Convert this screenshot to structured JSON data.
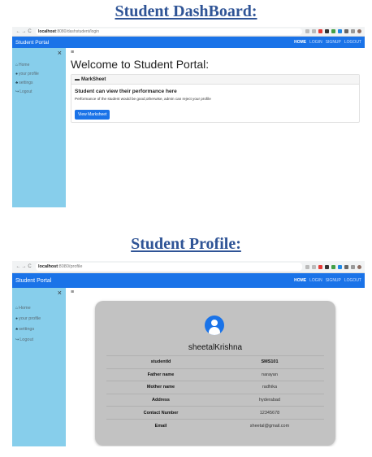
{
  "headings": {
    "dashboard": "Student DashBoard:",
    "profile": "Student Profile:"
  },
  "dashboard": {
    "browser": {
      "back": "←",
      "forward": "→",
      "reload": "C",
      "url_host": "localhost",
      "url_path": ":8080/dashstudent/login",
      "icons": [
        "share-icon",
        "star-icon",
        "ext-red-icon",
        "ext-dark-icon",
        "ext-green-icon",
        "ext-blue-icon",
        "puzzle-icon",
        "sidebar-icon",
        "avatar-icon",
        "more-icon"
      ]
    },
    "nav": {
      "brand": "Student Portal",
      "links": [
        "HOME",
        "LOGIN",
        "SIGNUP",
        "LOGOUT"
      ]
    },
    "sidebar": {
      "close": "×",
      "items": [
        "Home",
        "your profile",
        "settings",
        "Logout"
      ]
    },
    "main": {
      "hamburger": "≡",
      "title": "Welcome to Student Portal:",
      "card_header": "MarkSheet",
      "card_title": "Student can view their performance here",
      "card_text": "Performance of the student would be good,otherwise, admin can reject your profile",
      "button": "View Marksheet"
    }
  },
  "profile": {
    "browser": {
      "back": "←",
      "forward": "→",
      "reload": "C",
      "url_host": "localhost",
      "url_path": ":8080/profile"
    },
    "nav": {
      "brand": "Student Portal",
      "links": [
        "HOME",
        "LOGIN",
        "SIGNUP",
        "LOGOUT"
      ]
    },
    "sidebar": {
      "close": "×",
      "items": [
        "Home",
        "your profile",
        "settings",
        "Logout"
      ]
    },
    "main": {
      "hamburger": "≡",
      "name": "sheetalKrishna",
      "rows": [
        {
          "label": "studentId",
          "value": "SMS101"
        },
        {
          "label": "Father name",
          "value": "narayan"
        },
        {
          "label": "Mother name",
          "value": "radhika"
        },
        {
          "label": "Address",
          "value": "hyderabad"
        },
        {
          "label": "Contact Number",
          "value": "12345678"
        },
        {
          "label": "Email",
          "value": "sheetal@gmail.com"
        }
      ]
    }
  },
  "colors": {
    "heading": "#2f5496",
    "navbar": "#1a73e8",
    "sidebar": "#87ceeb",
    "profile_card": "#c2c2c2"
  }
}
